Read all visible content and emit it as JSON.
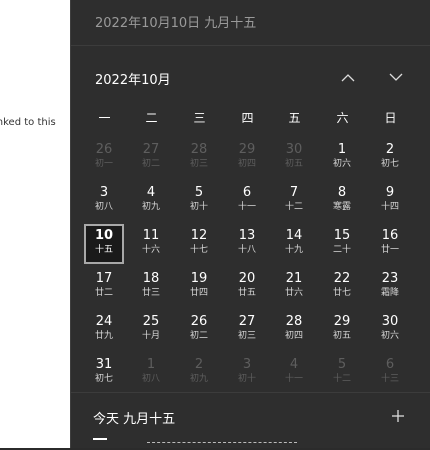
{
  "background_text": "inked to this",
  "header": {
    "date": "2022年10月10日 九月十五"
  },
  "calendar": {
    "month_label": "2022年10月",
    "weekdays": [
      "一",
      "二",
      "三",
      "四",
      "五",
      "六",
      "日"
    ],
    "weeks": [
      [
        {
          "day": "26",
          "lunar": "初一",
          "state": "prev"
        },
        {
          "day": "27",
          "lunar": "初二",
          "state": "prev"
        },
        {
          "day": "28",
          "lunar": "初三",
          "state": "prev"
        },
        {
          "day": "29",
          "lunar": "初四",
          "state": "prev"
        },
        {
          "day": "30",
          "lunar": "初五",
          "state": "prev"
        },
        {
          "day": "1",
          "lunar": "初六",
          "state": "cur"
        },
        {
          "day": "2",
          "lunar": "初七",
          "state": "cur"
        }
      ],
      [
        {
          "day": "3",
          "lunar": "初八",
          "state": "cur"
        },
        {
          "day": "4",
          "lunar": "初九",
          "state": "cur"
        },
        {
          "day": "5",
          "lunar": "初十",
          "state": "cur"
        },
        {
          "day": "6",
          "lunar": "十一",
          "state": "cur"
        },
        {
          "day": "7",
          "lunar": "十二",
          "state": "cur"
        },
        {
          "day": "8",
          "lunar": "寒露",
          "state": "cur"
        },
        {
          "day": "9",
          "lunar": "十四",
          "state": "cur"
        }
      ],
      [
        {
          "day": "10",
          "lunar": "十五",
          "state": "today"
        },
        {
          "day": "11",
          "lunar": "十六",
          "state": "cur"
        },
        {
          "day": "12",
          "lunar": "十七",
          "state": "cur"
        },
        {
          "day": "13",
          "lunar": "十八",
          "state": "cur"
        },
        {
          "day": "14",
          "lunar": "十九",
          "state": "cur"
        },
        {
          "day": "15",
          "lunar": "二十",
          "state": "cur"
        },
        {
          "day": "16",
          "lunar": "廿一",
          "state": "cur"
        }
      ],
      [
        {
          "day": "17",
          "lunar": "廿二",
          "state": "cur"
        },
        {
          "day": "18",
          "lunar": "廿三",
          "state": "cur"
        },
        {
          "day": "19",
          "lunar": "廿四",
          "state": "cur"
        },
        {
          "day": "20",
          "lunar": "廿五",
          "state": "cur"
        },
        {
          "day": "21",
          "lunar": "廿六",
          "state": "cur"
        },
        {
          "day": "22",
          "lunar": "廿七",
          "state": "cur"
        },
        {
          "day": "23",
          "lunar": "霜降",
          "state": "cur"
        }
      ],
      [
        {
          "day": "24",
          "lunar": "廿九",
          "state": "cur"
        },
        {
          "day": "25",
          "lunar": "十月",
          "state": "cur"
        },
        {
          "day": "26",
          "lunar": "初二",
          "state": "cur"
        },
        {
          "day": "27",
          "lunar": "初三",
          "state": "cur"
        },
        {
          "day": "28",
          "lunar": "初四",
          "state": "cur"
        },
        {
          "day": "29",
          "lunar": "初五",
          "state": "cur"
        },
        {
          "day": "30",
          "lunar": "初六",
          "state": "cur"
        }
      ],
      [
        {
          "day": "31",
          "lunar": "初七",
          "state": "cur"
        },
        {
          "day": "1",
          "lunar": "初八",
          "state": "next"
        },
        {
          "day": "2",
          "lunar": "初九",
          "state": "next"
        },
        {
          "day": "3",
          "lunar": "初十",
          "state": "next"
        },
        {
          "day": "4",
          "lunar": "十一",
          "state": "next"
        },
        {
          "day": "5",
          "lunar": "十二",
          "state": "next"
        },
        {
          "day": "6",
          "lunar": "十三",
          "state": "next"
        }
      ]
    ]
  },
  "agenda": {
    "title": "今天 九月十五"
  },
  "icons": {
    "prev_month": "chevron-up-icon",
    "next_month": "chevron-down-icon",
    "add_event": "plus-icon"
  },
  "colors": {
    "flyout_bg": "#2e2e2e",
    "dim_text": "#5e5e5e",
    "today_border": "#a8a8a8"
  }
}
